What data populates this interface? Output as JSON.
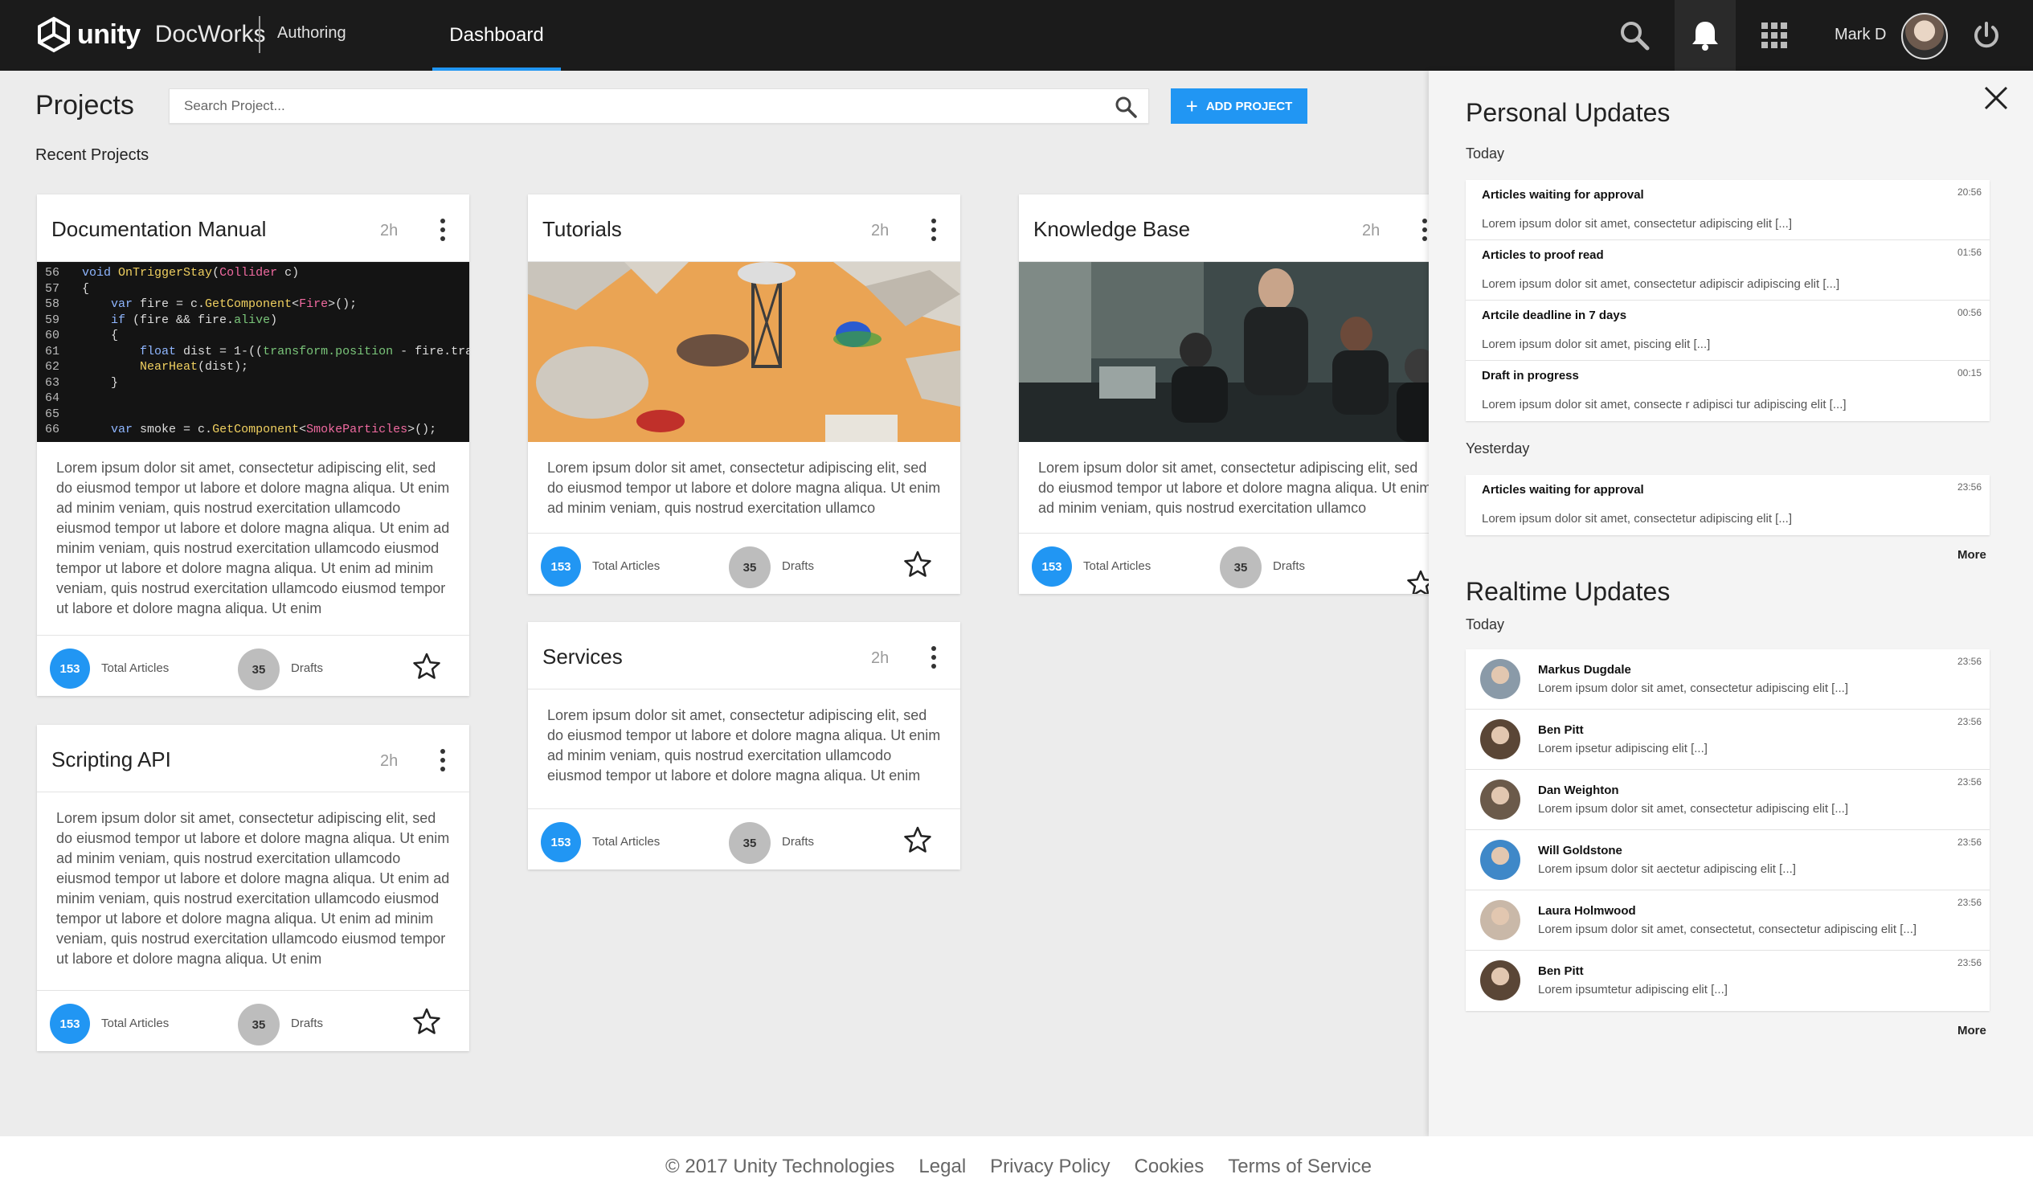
{
  "app": {
    "brand": "unity",
    "product": "DocWorks",
    "nav_authoring": "Authoring",
    "nav_dashboard": "Dashboard",
    "user_name": "Mark D",
    "accent_color": "#2196f3"
  },
  "main": {
    "title": "Projects",
    "search_placeholder": "Search Project...",
    "add_button": "ADD PROJECT",
    "recent_label": "Recent Projects"
  },
  "cards": [
    {
      "title": "Documentation Manual",
      "time": "2h",
      "image": "code-screenshot",
      "desc": "Lorem ipsum dolor sit amet, consectetur adipiscing elit, sed do eiusmod tempor  ut labore et dolore magna aliqua. Ut enim ad minim veniam, quis nostrud exercitation ullamcodo eiusmod tempor  ut labore et dolore magna aliqua. Ut enim ad minim veniam, quis nostrud exercitation ullamcodo eiusmod tempor  ut labore et dolore magna aliqua. Ut enim ad minim veniam, quis nostrud exercitation ullamcodo eiusmod tempor  ut labore et dolore magna aliqua. Ut enim",
      "total": "153",
      "total_label": "Total Articles",
      "drafts": "35",
      "drafts_label": "Drafts"
    },
    {
      "title": "Tutorials",
      "time": "2h",
      "image": "game-scene",
      "desc": "Lorem ipsum dolor sit amet, consectetur adipiscing elit, sed do eiusmod tempor  ut labore et dolore magna aliqua. Ut enim ad minim veniam, quis nostrud exercitation ullamco",
      "total": "153",
      "total_label": "Total Articles",
      "drafts": "35",
      "drafts_label": "Drafts"
    },
    {
      "title": "Knowledge Base",
      "time": "2h",
      "image": "team-photo",
      "desc": "Lorem ipsum dolor sit amet, consectetur adipiscing elit, sed do eiusmod tempor  ut labore et dolore magna aliqua. Ut enim ad minim veniam, quis nostrud exercitation ullamco",
      "total": "153",
      "total_label": "Total Articles",
      "drafts": "35",
      "drafts_label": "Drafts"
    },
    {
      "title": "Services",
      "time": "2h",
      "desc": "Lorem ipsum dolor sit amet, consectetur adipiscing elit, sed do eiusmod tempor  ut labore et dolore magna aliqua. Ut enim ad minim veniam, quis nostrud exercitation ullamcodo eiusmod tempor  ut labore et dolore magna aliqua. Ut enim",
      "total": "153",
      "total_label": "Total Articles",
      "drafts": "35",
      "drafts_label": "Drafts"
    },
    {
      "title": "Scripting API",
      "time": "2h",
      "desc": "Lorem ipsum dolor sit amet, consectetur adipiscing elit, sed do eiusmod tempor  ut labore et dolore magna aliqua. Ut enim ad minim veniam, quis nostrud exercitation ullamcodo eiusmod tempor  ut labore et dolore magna aliqua. Ut enim ad minim veniam, quis nostrud exercitation ullamcodo eiusmod tempor  ut labore et dolore magna aliqua. Ut enim ad minim veniam, quis nostrud exercitation ullamcodo eiusmod tempor  ut labore et dolore magna aliqua. Ut enim",
      "total": "153",
      "total_label": "Total Articles",
      "drafts": "35",
      "drafts_label": "Drafts"
    }
  ],
  "code_lines": [
    [
      "56",
      "void OnTriggerStay(Collider c)"
    ],
    [
      "57",
      "{"
    ],
    [
      "58",
      "    var fire = c.GetComponent<Fire>();"
    ],
    [
      "59",
      "    if (fire && fire.alive)"
    ],
    [
      "60",
      "    {"
    ],
    [
      "61",
      "        float dist = 1-((transform.position - fire.trans"
    ],
    [
      "62",
      "        NearHeat(dist);"
    ],
    [
      "63",
      "    }"
    ],
    [
      "64",
      ""
    ],
    [
      "65",
      ""
    ],
    [
      "66",
      "    var smoke = c.GetComponent<SmokeParticles>();"
    ]
  ],
  "panel": {
    "personal_title": "Personal Updates",
    "today_label": "Today",
    "yesterday_label": "Yesterday",
    "more_label": "More",
    "personal_today": [
      {
        "title": "Articles waiting for approval",
        "time": "20:56",
        "text": "Lorem ipsum dolor sit amet, consectetur adipiscing elit [...]"
      },
      {
        "title": "Articles to proof read",
        "time": "01:56",
        "text": "Lorem ipsum dolor sit amet, consectetur adipiscir adipiscing elit [...]"
      },
      {
        "title": "Artcile deadline in 7 days",
        "time": "00:56",
        "text": "Lorem ipsum dolor sit amet, piscing elit [...]"
      },
      {
        "title": "Draft in progress",
        "time": "00:15",
        "text": "Lorem ipsum dolor sit amet, consecte r adipisci tur adipiscing elit [...]"
      }
    ],
    "personal_yesterday": [
      {
        "title": "Articles waiting for approval",
        "time": "23:56",
        "text": "Lorem ipsum dolor sit amet, consectetur adipiscing elit [...]"
      }
    ],
    "realtime_title": "Realtime Updates",
    "realtime_today": [
      {
        "name": "Markus Dugdale",
        "time": "23:56",
        "text": "Lorem ipsum dolor sit amet, consectetur adipiscing elit [...]",
        "color": "#8a9aa8"
      },
      {
        "name": "Ben Pitt",
        "time": "23:56",
        "text": "Lorem ipsetur adipiscing elit [...]",
        "color": "#5a4636"
      },
      {
        "name": "Dan Weighton",
        "time": "23:56",
        "text": "Lorem ipsum dolor sit amet, consectetur adipiscing elit [...]",
        "color": "#6b5a4a"
      },
      {
        "name": "Will Goldstone",
        "time": "23:56",
        "text": "Lorem ipsum dolor sit aectetur adipiscing elit [...]",
        "color": "#3f88c8"
      },
      {
        "name": "Laura Holmwood",
        "time": "23:56",
        "text": "Lorem ipsum dolor sit amet, consectetut, consectetur adipiscing elit [...]",
        "color": "#c9b8a8"
      },
      {
        "name": "Ben Pitt",
        "time": "23:56",
        "text": "Lorem ipsumtetur adipiscing elit [...]",
        "color": "#5a4636"
      }
    ]
  },
  "footer": {
    "copyright": "© 2017 Unity Technologies",
    "legal": "Legal",
    "privacy": "Privacy Policy",
    "cookies": "Cookies",
    "terms": "Terms of Service"
  }
}
